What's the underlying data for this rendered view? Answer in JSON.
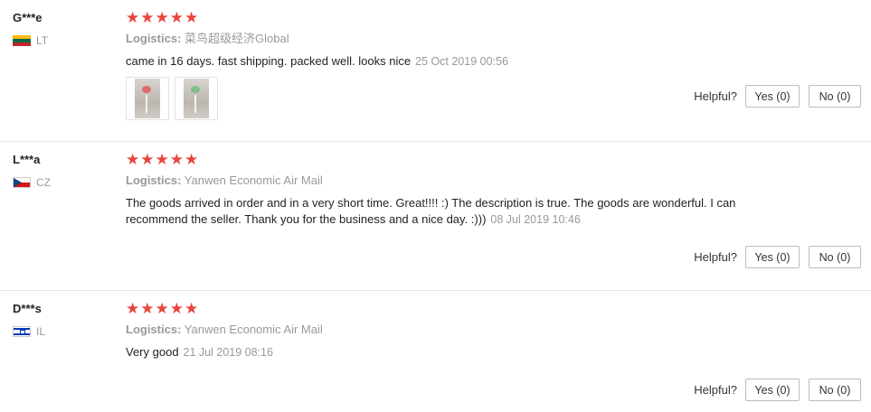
{
  "reviews": [
    {
      "user": "G***e",
      "country": "LT",
      "flag": "lithuania-flag",
      "stars": "★★★★★",
      "rating": 5,
      "logistics_label": "Logistics:",
      "logistics": "菜鸟超级经济Global",
      "text": "came in 16 days. fast shipping. packed well. looks nice",
      "date": "25 Oct 2019 00:56",
      "helpful_label": "Helpful?",
      "yes_label": "Yes (0)",
      "no_label": "No (0)"
    },
    {
      "user": "L***a",
      "country": "CZ",
      "flag": "czech-flag",
      "stars": "★★★★★",
      "rating": 5,
      "logistics_label": "Logistics:",
      "logistics": "Yanwen Economic Air Mail",
      "text": "The goods arrived in order and in a very short time. Great!!!! :) The description is true. The goods are wonderful. I can recommend the seller. Thank you for the business and a nice day. :)))",
      "date": "08 Jul 2019 10:46",
      "helpful_label": "Helpful?",
      "yes_label": "Yes (0)",
      "no_label": "No (0)"
    },
    {
      "user": "D***s",
      "country": "IL",
      "flag": "israel-flag",
      "stars": "★★★★★",
      "rating": 5,
      "logistics_label": "Logistics:",
      "logistics": "Yanwen Economic Air Mail",
      "text": "Very good",
      "date": "21 Jul 2019 08:16",
      "helpful_label": "Helpful?",
      "yes_label": "Yes (0)",
      "no_label": "No (0)"
    }
  ]
}
